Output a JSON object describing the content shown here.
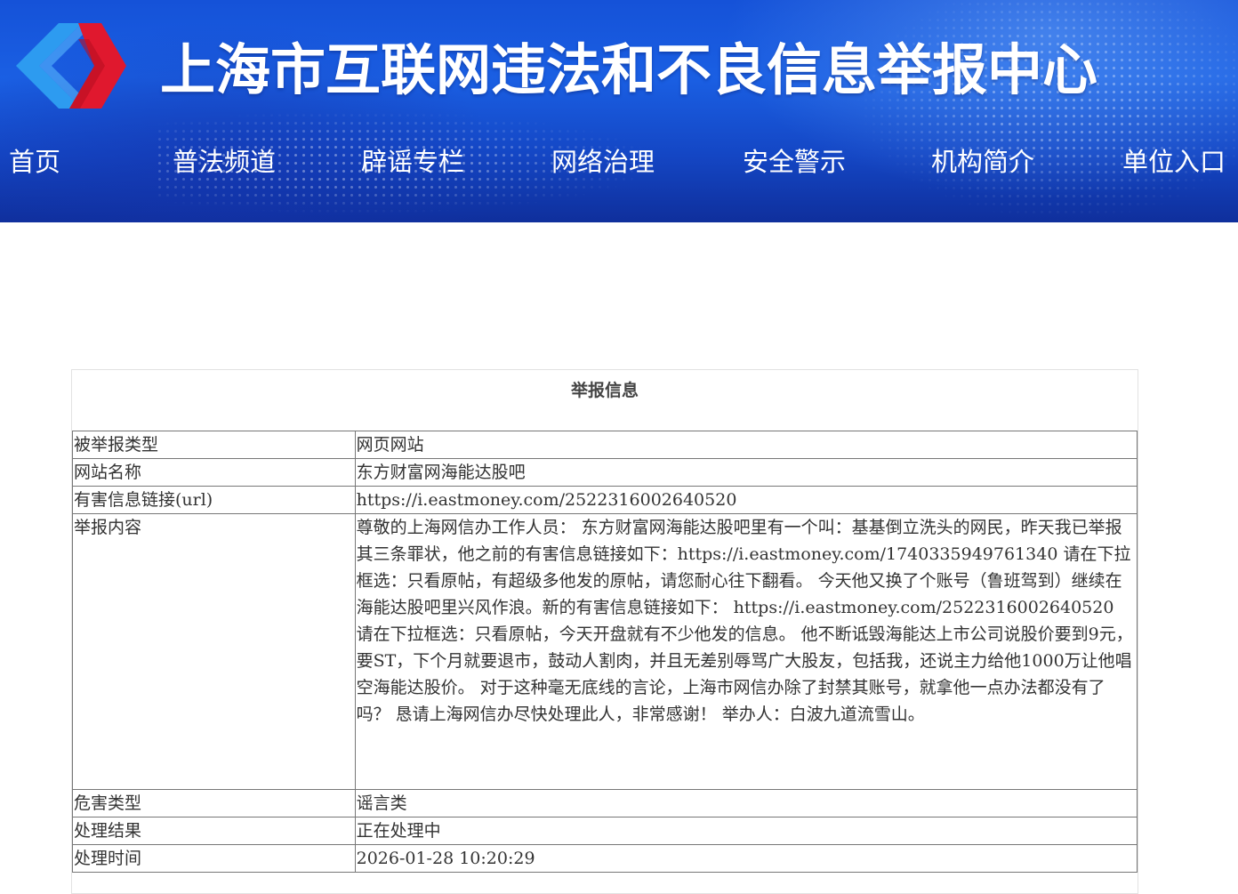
{
  "header": {
    "title": "上海市互联网违法和不良信息举报中心",
    "logo_icon": "diamond-chevron-logo",
    "colors": {
      "background": "#1a5fe3",
      "logo_blue": "#2d9bf0",
      "logo_red": "#e0182e",
      "text": "#ffffff"
    }
  },
  "nav": {
    "items": [
      {
        "label": "首页"
      },
      {
        "label": "普法频道"
      },
      {
        "label": "辟谣专栏"
      },
      {
        "label": "网络治理"
      },
      {
        "label": "安全警示"
      },
      {
        "label": "机构简介"
      },
      {
        "label": "单位入口"
      }
    ]
  },
  "report": {
    "title": "举报信息",
    "rows": [
      {
        "label": "被举报类型",
        "value": "网页网站"
      },
      {
        "label": "网站名称",
        "value": "东方财富网海能达股吧"
      },
      {
        "label": "有害信息链接(url)",
        "value": "https://i.eastmoney.com/2522316002640520"
      },
      {
        "label": "举报内容",
        "value": "尊敬的上海网信办工作人员： 东方财富网海能达股吧里有一个叫：基基倒立洗头的网民，昨天我已举报其三条罪状，他之前的有害信息链接如下：https://i.eastmoney.com/1740335949761340 请在下拉框选：只看原帖，有超级多他发的原帖，请您耐心往下翻看。 今天他又换了个账号（鲁班驾到）继续在海能达股吧里兴风作浪。新的有害信息链接如下： https://i.eastmoney.com/2522316002640520 请在下拉框选：只看原帖，今天开盘就有不少他发的信息。 他不断诋毁海能达上市公司说股价要到9元，要ST，下个月就要退市，鼓动人割肉，并且无差别辱骂广大股友，包括我，还说主力给他1000万让他唱空海能达股价。 对于这种毫无底线的言论，上海市网信办除了封禁其账号，就拿他一点办法都没有了吗？ 恳请上海网信办尽快处理此人，非常感谢！ 举办人：白波九道流雪山。"
      },
      {
        "label": "危害类型",
        "value": "谣言类"
      },
      {
        "label": "处理结果",
        "value": "正在处理中"
      },
      {
        "label": "处理时间",
        "value": "2026-01-28 10:20:29"
      }
    ]
  }
}
